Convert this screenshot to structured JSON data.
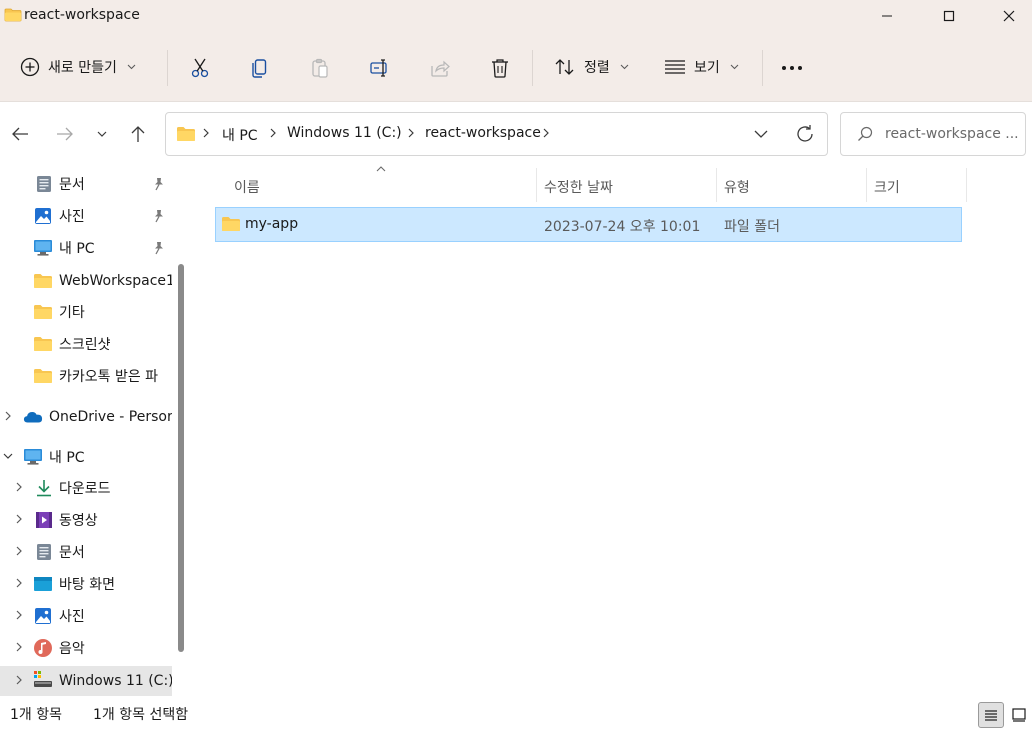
{
  "window": {
    "title": "react-workspace"
  },
  "toolbar": {
    "new_label": "새로 만들기",
    "sort_label": "정렬",
    "view_label": "보기"
  },
  "address": {
    "crumbs": [
      "내 PC",
      "Windows 11 (C:)",
      "react-workspace"
    ]
  },
  "search": {
    "placeholder": "react-workspace ..."
  },
  "sidebar": {
    "quick_items": [
      {
        "label": "문서",
        "icon": "documents-icon",
        "pinned": true
      },
      {
        "label": "사진",
        "icon": "pictures-icon",
        "pinned": true
      },
      {
        "label": "내 PC",
        "icon": "this-pc-icon",
        "pinned": true
      },
      {
        "label": "WebWorkspace1",
        "icon": "folder-icon",
        "pinned": false
      },
      {
        "label": "기타",
        "icon": "folder-icon",
        "pinned": false
      },
      {
        "label": "스크린샷",
        "icon": "folder-icon",
        "pinned": false
      },
      {
        "label": "카카오톡 받은 파",
        "icon": "folder-icon",
        "pinned": false
      }
    ],
    "onedrive_label": "OneDrive - Persor",
    "thispc_label": "내 PC",
    "pc_items": [
      {
        "label": "다운로드",
        "icon": "download-icon"
      },
      {
        "label": "동영상",
        "icon": "videos-icon"
      },
      {
        "label": "문서",
        "icon": "documents-icon"
      },
      {
        "label": "바탕 화면",
        "icon": "desktop-icon"
      },
      {
        "label": "사진",
        "icon": "pictures-icon"
      },
      {
        "label": "음악",
        "icon": "music-icon"
      },
      {
        "label": "Windows 11 (C:)",
        "icon": "drive-icon"
      }
    ]
  },
  "columns": {
    "name": "이름",
    "modified": "수정한 날짜",
    "type": "유형",
    "size": "크기"
  },
  "files": [
    {
      "name": "my-app",
      "modified": "2023-07-24 오후 10:01",
      "type": "파일 폴더",
      "size": ""
    }
  ],
  "status": {
    "count": "1개 항목",
    "selected": "1개 항목 선택함"
  },
  "colors": {
    "accent": "#0067c0",
    "selection": "#cce8ff",
    "folder": "#f8c651",
    "chrome": "#f3ece8"
  }
}
